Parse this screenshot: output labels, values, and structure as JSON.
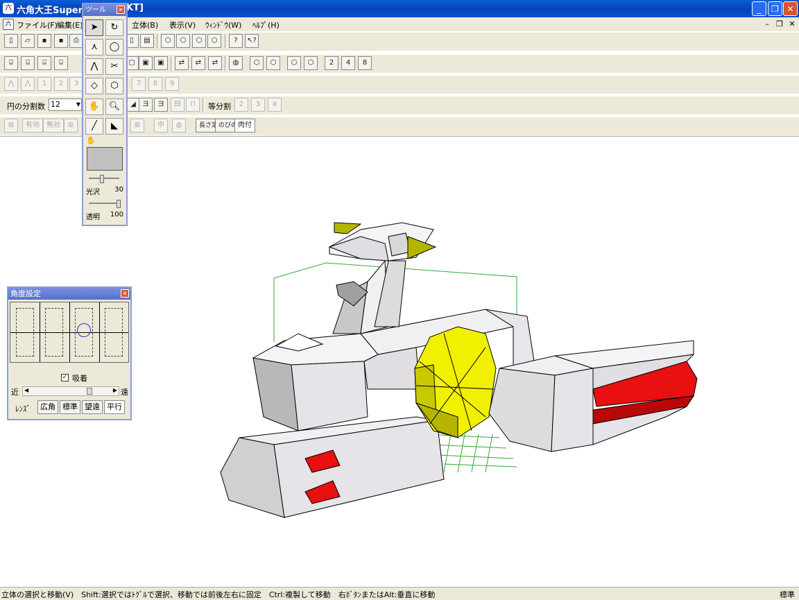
{
  "window": {
    "title": "六角大王Super",
    "title_suffix": "KT]",
    "app_icon": "hexagon-app-icon"
  },
  "menu": {
    "items": [
      "ファイル(F)",
      "編集(E)",
      "立体(B)",
      "表示(V)",
      "ｳｨﾝﾄﾞｳ(W)",
      "ﾍﾙﾌﾟ(H)"
    ]
  },
  "toolbar": {
    "row4_numbers": [
      "1",
      "2",
      "3",
      "7",
      "8",
      "9"
    ],
    "row5_buttons": [
      "2",
      "4",
      "8"
    ],
    "circle_division_label": "円の分割数",
    "circle_division_value": "12",
    "equal_division_label": "等分割",
    "equal_division_numbers": [
      "2",
      "3",
      "4"
    ],
    "row6_labels": [
      "有効",
      "無効",
      "長さ定",
      "のびのび",
      "肉付"
    ]
  },
  "tool_palette": {
    "title": "ツール",
    "gloss_label": "光沢",
    "gloss_value": "30",
    "transparency_label": "透明",
    "transparency_value": "100",
    "color_swatch": "#c0c0c0"
  },
  "angle_panel": {
    "title": "角度設定",
    "snap_label": "吸着",
    "snap_checked": true,
    "near_label": "近",
    "far_label": "遠",
    "lens_label": "ﾚﾝｽﾞ",
    "lens_options": [
      "広角",
      "標準",
      "望遠",
      "平行"
    ]
  },
  "status": {
    "text": "立体の選択と移動(V)　Shift:選択ではﾄｸﾞﾙで選択、移動では前後左右に固定　Ctrl:複製して移動　右ﾎﾞﾀﾝまたはAlt:垂直に移動",
    "mode": "標準"
  },
  "colors": {
    "titlebar": "#0842b8",
    "chrome": "#ece9d8",
    "model_body": "#e8e6ea",
    "model_red": "#e81010",
    "model_yellow": "#f0f000",
    "bbox_green": "#33aa33"
  }
}
